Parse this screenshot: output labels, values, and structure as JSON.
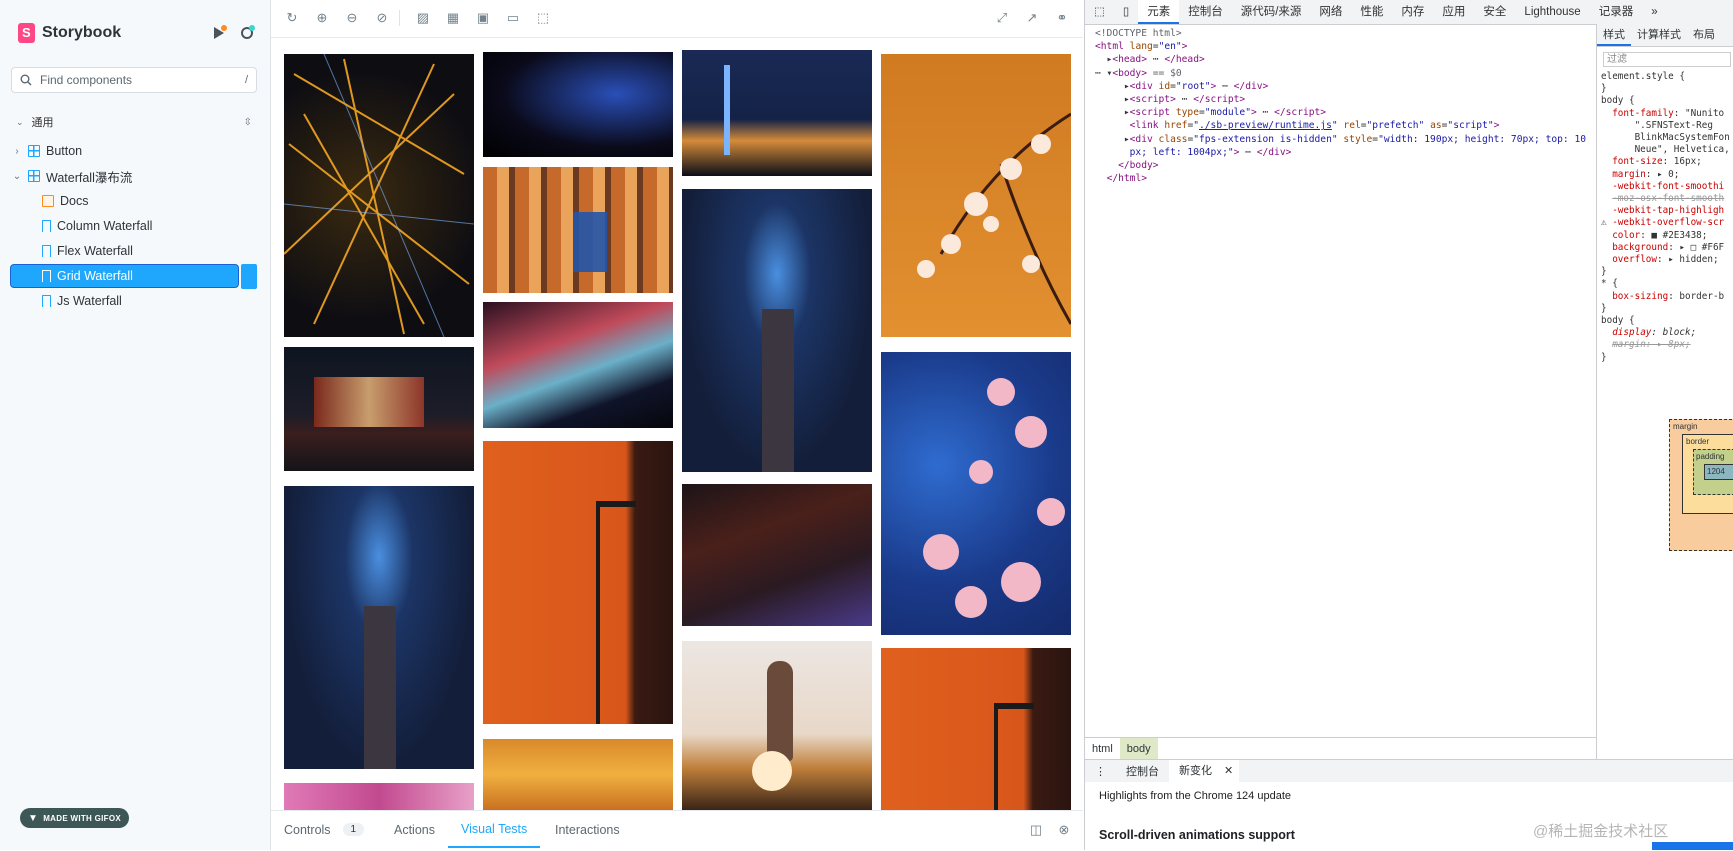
{
  "sidebar": {
    "brand": "Storybook",
    "search_placeholder": "Find components",
    "search_shortcut": "/",
    "section_label": "通用",
    "items": [
      {
        "label": "Button",
        "type": "component",
        "expanded": false
      },
      {
        "label": "Waterfall瀑布流",
        "type": "component",
        "expanded": true
      },
      {
        "label": "Docs",
        "type": "docs"
      },
      {
        "label": "Column Waterfall",
        "type": "story"
      },
      {
        "label": "Flex Waterfall",
        "type": "story"
      },
      {
        "label": "Grid Waterfall",
        "type": "story",
        "selected": true
      },
      {
        "label": "Js Waterfall",
        "type": "story"
      }
    ],
    "gifox_label": "MADE WITH GIFOX"
  },
  "addons": {
    "tabs": [
      {
        "label": "Controls",
        "badge": "1"
      },
      {
        "label": "Actions"
      },
      {
        "label": "Visual Tests",
        "active": true
      },
      {
        "label": "Interactions"
      }
    ]
  },
  "devtools": {
    "tabs": [
      "元素",
      "控制台",
      "源代码/来源",
      "网络",
      "性能",
      "内存",
      "应用",
      "安全",
      "Lighthouse",
      "记录器"
    ],
    "active_tab": "元素",
    "style_tabs": [
      "样式",
      "计算样式",
      "布局"
    ],
    "filter_placeholder": "过滤",
    "breadcrumbs": [
      "html",
      "body"
    ],
    "drawer_tabs": [
      "控制台",
      "新变化"
    ],
    "drawer_line1": "Highlights from the Chrome 124 update",
    "drawer_line2": "Scroll-driven animations support",
    "watermark": "@稀土掘金技术社区",
    "box_labels": {
      "margin": "margin",
      "border": "border",
      "padding": "padding",
      "content": "1204"
    }
  },
  "colors": {
    "accent": "#1ea7fd",
    "selected_border": "#1a61d6",
    "storybook_brand": "#ff4785"
  }
}
